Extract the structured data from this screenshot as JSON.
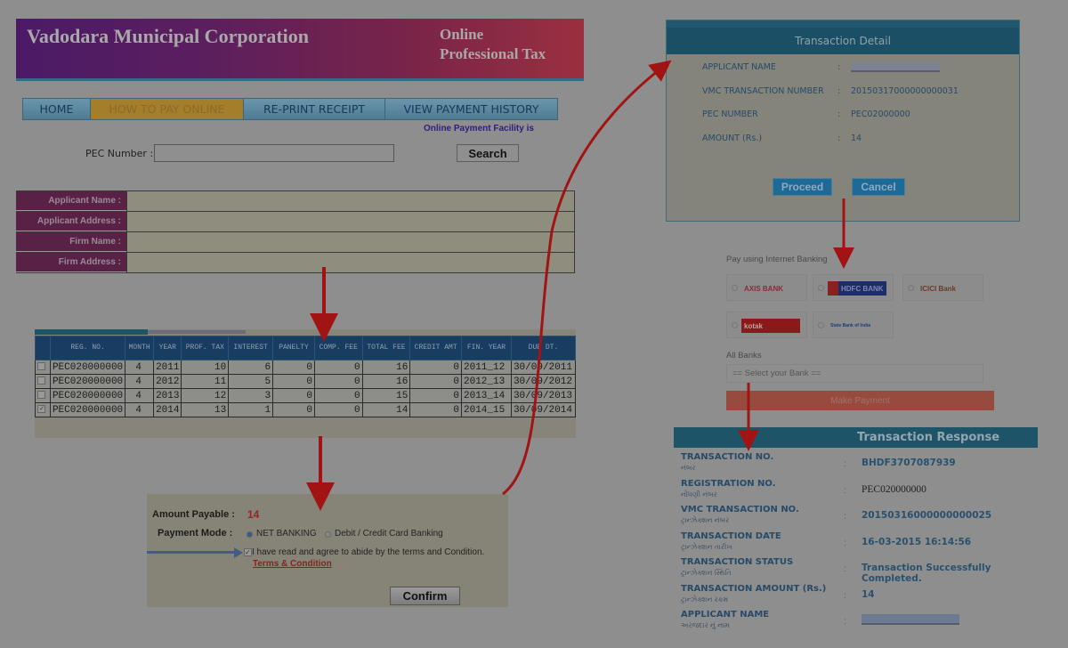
{
  "header": {
    "title": "Vadodara Municipal Corporation",
    "subtitle_line1": "Online",
    "subtitle_line2": "Professional Tax"
  },
  "nav": {
    "items": [
      {
        "label": "HOME",
        "active": false
      },
      {
        "label": "HOW TO PAY ONLINE",
        "active": true
      },
      {
        "label": "RE-PRINT RECEIPT",
        "active": false
      },
      {
        "label": "VIEW PAYMENT HISTORY",
        "active": false
      }
    ],
    "notice": "Online Payment Facility is"
  },
  "search": {
    "label": "PEC Number :",
    "value": "",
    "button": "Search"
  },
  "applicant_form": {
    "fields": [
      {
        "label": "Applicant Name :",
        "value": ""
      },
      {
        "label": "Applicant Address :",
        "value": ""
      },
      {
        "label": "Firm Name :",
        "value": ""
      },
      {
        "label": "Firm Address :",
        "value": ""
      }
    ]
  },
  "dues_table": {
    "columns": [
      "",
      "REG. NO.",
      "MONTH",
      "YEAR",
      "PROF. TAX",
      "INTEREST",
      "PANELTY",
      "COMP. FEE",
      "TOTAL FEE",
      "CREDIT AMT",
      "FIN. YEAR",
      "DUE DT."
    ],
    "rows": [
      {
        "checked": false,
        "reg_no": "PEC020000000",
        "month": "4",
        "year": "2011",
        "prof_tax": "10",
        "interest": "6",
        "penalty": "0",
        "comp_fee": "0",
        "total_fee": "16",
        "credit_amt": "0",
        "fin_year": "2011_12",
        "due_dt": "30/09/2011"
      },
      {
        "checked": false,
        "reg_no": "PEC020000000",
        "month": "4",
        "year": "2012",
        "prof_tax": "11",
        "interest": "5",
        "penalty": "0",
        "comp_fee": "0",
        "total_fee": "16",
        "credit_amt": "0",
        "fin_year": "2012_13",
        "due_dt": "30/09/2012"
      },
      {
        "checked": false,
        "reg_no": "PEC020000000",
        "month": "4",
        "year": "2013",
        "prof_tax": "12",
        "interest": "3",
        "penalty": "0",
        "comp_fee": "0",
        "total_fee": "15",
        "credit_amt": "0",
        "fin_year": "2013_14",
        "due_dt": "30/09/2013"
      },
      {
        "checked": true,
        "reg_no": "PEC020000000",
        "month": "4",
        "year": "2014",
        "prof_tax": "13",
        "interest": "1",
        "penalty": "0",
        "comp_fee": "0",
        "total_fee": "14",
        "credit_amt": "0",
        "fin_year": "2014_15",
        "due_dt": "30/09/2014"
      }
    ]
  },
  "payment": {
    "amount_label": "Amount Payable :",
    "amount_value": "14",
    "mode_label": "Payment Mode :",
    "modes": [
      {
        "label": "NET BANKING",
        "selected": true
      },
      {
        "label": "Debit / Credit Card Banking",
        "selected": false
      }
    ],
    "agree_text": "I have read and agree to abide by the terms and Condition.",
    "agree_checked": true,
    "terms_link": "Terms & Condition",
    "confirm": "Confirm"
  },
  "transaction_detail": {
    "title": "Transaction Detail",
    "rows": [
      {
        "label": "APPLICANT NAME",
        "value": ""
      },
      {
        "label": "VMC TRANSACTION NUMBER",
        "value": "20150317000000000031"
      },
      {
        "label": "PEC NUMBER",
        "value": "PEC02000000"
      },
      {
        "label": "AMOUNT (Rs.)",
        "value": "14"
      }
    ],
    "proceed": "Proceed",
    "cancel": "Cancel"
  },
  "net_banking": {
    "label": "Pay using Internet Banking",
    "banks": [
      {
        "name": "AXIS BANK",
        "color": "#8a2a3a"
      },
      {
        "name": "HDFC BANK",
        "color": "#1d2d6a"
      },
      {
        "name": "ICICI Bank",
        "color": "#8a3a26"
      },
      {
        "name": "kotak",
        "color": "#8a1a1a"
      },
      {
        "name": "State Bank of India",
        "color": "#1d3d78"
      }
    ],
    "all_banks_label": "All Banks",
    "select_placeholder": "== Select your Bank ==",
    "make_payment": "Make Payment"
  },
  "transaction_response": {
    "title": "Transaction Response",
    "rows": [
      {
        "label": "TRANSACTION NO.",
        "gujarati": "નંબર",
        "value": "BHDF3707087939",
        "style": "blue"
      },
      {
        "label": "REGISTRATION NO.",
        "gujarati": "નોંધણી નંબર",
        "value": "PEC020000000",
        "style": "black"
      },
      {
        "label": "VMC TRANSACTION NO.",
        "gujarati": "ટ્રાન્ઝેક્શન નંબર",
        "value": "20150316000000000025",
        "style": "blue"
      },
      {
        "label": "TRANSACTION DATE",
        "gujarati": "ટ્રાન્ઝેક્શન તારીખ",
        "value": "16-03-2015 16:14:56",
        "style": "blue"
      },
      {
        "label": "TRANSACTION STATUS",
        "gujarati": "ટ્રાન્ઝેક્શન સ્થિતિ",
        "value": "Transaction Successfully Completed.",
        "style": "blue"
      },
      {
        "label": "TRANSACTION AMOUNT (Rs.)",
        "gujarati": "ટ્રાન્ઝેક્શન રકમ",
        "value": "14",
        "style": "blue"
      },
      {
        "label": "APPLICANT NAME",
        "gujarati": "અરજદાર નું નામ",
        "value": "",
        "style": "blur"
      }
    ]
  }
}
